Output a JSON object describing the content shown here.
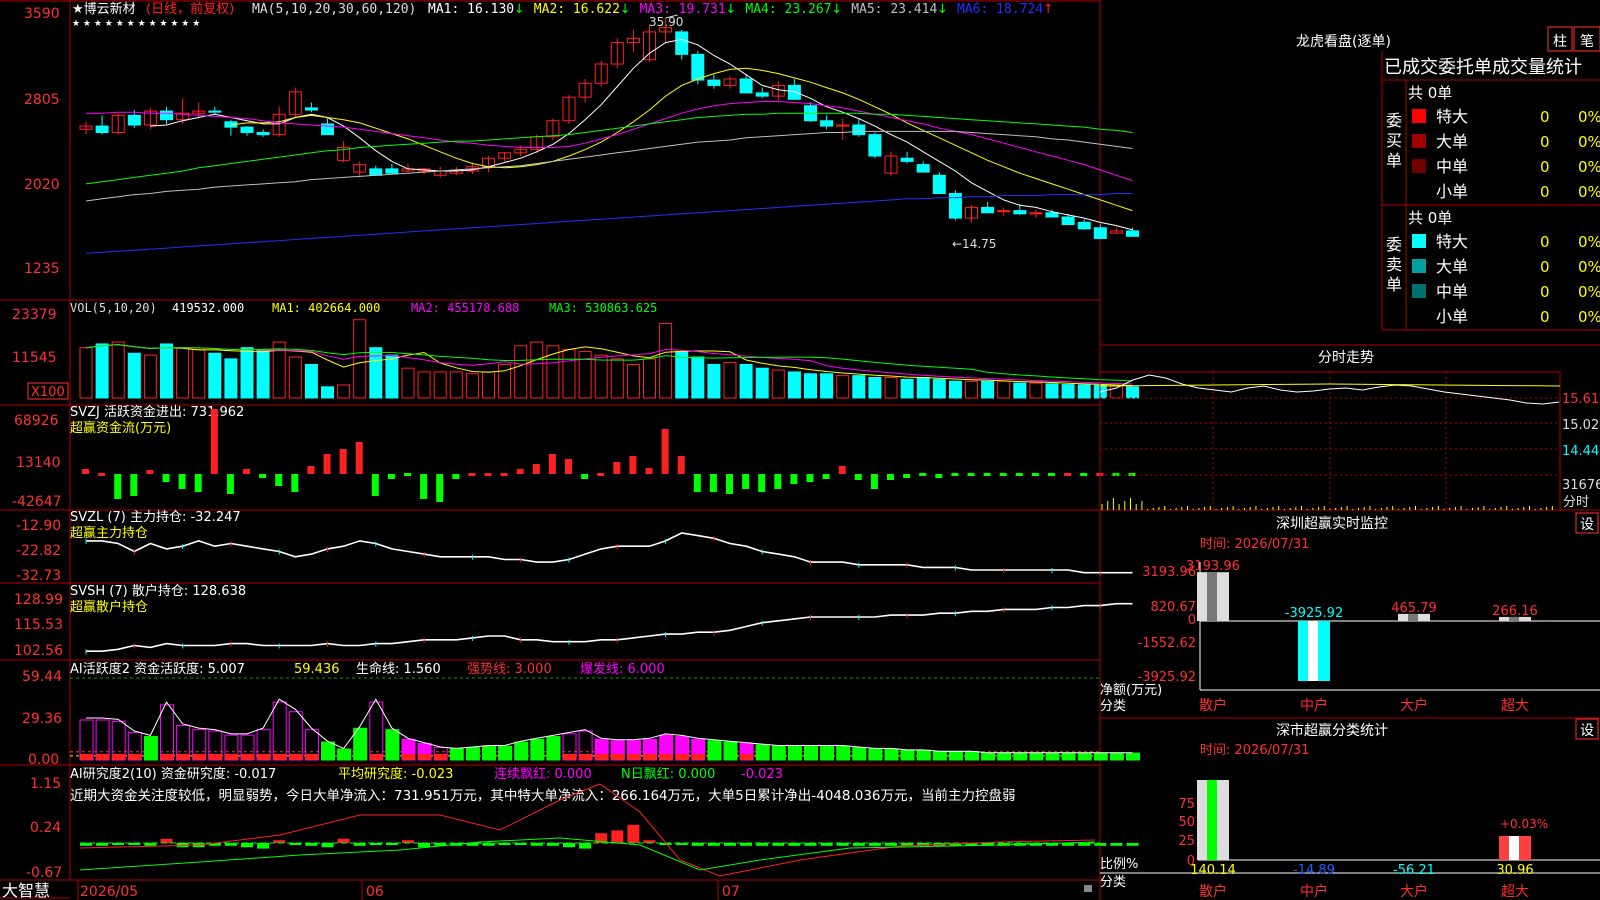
{
  "colors": {
    "up": "#ff2020",
    "down": "#00ffff",
    "green": "#00ff00",
    "yellow": "#ffff00",
    "magenta": "#ff00ff",
    "white": "#ffffff",
    "grid": "#b00000",
    "blue": "#2030ff",
    "grey": "#c0c0c0"
  },
  "kline": {
    "stock_name": "★博云新材",
    "mode": "(日线，前复权)",
    "ma_params": "MA(5,10,20,30,60,120)",
    "ma_values": [
      {
        "label": "MA1: 16.130",
        "arrow": "↓",
        "color": "#ffffff"
      },
      {
        "label": "MA2: 16.622",
        "arrow": "↓",
        "color": "#ffff00"
      },
      {
        "label": "MA3: 19.731",
        "arrow": "↓",
        "color": "#ff00ff"
      },
      {
        "label": "MA4: 23.267",
        "arrow": "↓",
        "color": "#00ff00"
      },
      {
        "label": "MA5: 23.414",
        "arrow": "↓",
        "color": "#c0c0c0"
      },
      {
        "label": "MA6: 18.724",
        "arrow": "↑",
        "color": "#2030ff"
      }
    ],
    "y_ticks": [
      "3590",
      "2805",
      "2020",
      "1235"
    ],
    "high_label": "35.90",
    "low_label": "←14.75",
    "stars": "★ ★ ★ ★ ★ ★ ★ ★ ★ ★ ★ ★"
  },
  "chart_data": {
    "type": "candlestick",
    "ylim": [
      12.35,
      35.9
    ],
    "candles": [
      [
        25.5,
        26.2,
        25.0,
        25.8
      ],
      [
        25.8,
        26.8,
        25.0,
        25.2
      ],
      [
        25.2,
        27.0,
        25.0,
        26.8
      ],
      [
        26.8,
        27.3,
        25.6,
        25.9
      ],
      [
        25.9,
        27.5,
        25.5,
        27.2
      ],
      [
        27.2,
        27.6,
        26.0,
        26.4
      ],
      [
        26.4,
        28.4,
        26.0,
        27.0
      ],
      [
        27.0,
        28.0,
        26.6,
        27.2
      ],
      [
        27.2,
        27.6,
        26.9,
        27.1
      ],
      [
        26.2,
        26.4,
        24.9,
        25.7
      ],
      [
        25.7,
        25.8,
        24.9,
        25.2
      ],
      [
        25.2,
        25.5,
        24.8,
        25.0
      ],
      [
        25.0,
        27.6,
        24.8,
        26.9
      ],
      [
        26.9,
        29.4,
        26.6,
        29.0
      ],
      [
        27.5,
        28.0,
        27.1,
        27.3
      ],
      [
        26.0,
        26.5,
        25.2,
        25.0
      ],
      [
        22.6,
        24.4,
        22.4,
        23.8
      ],
      [
        21.5,
        22.5,
        21.0,
        22.2
      ],
      [
        21.8,
        22.1,
        21.5,
        21.2
      ],
      [
        21.8,
        22.3,
        21.3,
        21.4
      ],
      [
        21.6,
        22.3,
        21.5,
        21.8
      ],
      [
        21.6,
        21.9,
        21.3,
        21.8
      ],
      [
        21.2,
        22.0,
        21.0,
        21.6
      ],
      [
        21.4,
        22.0,
        21.2,
        21.7
      ],
      [
        21.6,
        22.4,
        21.3,
        22.0
      ],
      [
        22.0,
        23.0,
        21.5,
        22.8
      ],
      [
        22.8,
        23.4,
        22.5,
        23.3
      ],
      [
        23.3,
        24.0,
        23.0,
        23.6
      ],
      [
        23.6,
        25.0,
        23.3,
        24.8
      ],
      [
        24.8,
        26.5,
        24.5,
        26.3
      ],
      [
        26.3,
        28.7,
        26.0,
        28.5
      ],
      [
        28.5,
        30.2,
        28.0,
        29.8
      ],
      [
        29.8,
        31.9,
        29.5,
        31.6
      ],
      [
        31.6,
        34.0,
        31.2,
        33.6
      ],
      [
        33.6,
        34.8,
        32.7,
        34.0
      ],
      [
        32.0,
        35.3,
        31.8,
        34.6
      ],
      [
        34.6,
        35.9,
        33.5,
        35.0
      ],
      [
        34.6,
        34.8,
        32.0,
        32.5
      ],
      [
        32.5,
        32.8,
        29.7,
        30.1
      ],
      [
        30.1,
        30.6,
        29.3,
        29.6
      ],
      [
        29.6,
        30.5,
        29.3,
        30.2
      ],
      [
        30.2,
        30.6,
        29.0,
        28.9
      ],
      [
        28.9,
        29.4,
        28.4,
        28.6
      ],
      [
        28.6,
        30.0,
        28.2,
        29.6
      ],
      [
        29.6,
        30.2,
        28.3,
        28.3
      ],
      [
        27.7,
        28.0,
        26.2,
        26.3
      ],
      [
        26.3,
        26.8,
        25.5,
        25.8
      ],
      [
        25.8,
        26.5,
        24.5,
        25.9
      ],
      [
        25.9,
        26.5,
        24.8,
        25.0
      ],
      [
        25.0,
        25.2,
        22.8,
        23.0
      ],
      [
        21.4,
        23.4,
        21.1,
        23.0
      ],
      [
        22.8,
        23.4,
        22.3,
        22.5
      ],
      [
        22.2,
        22.5,
        21.6,
        21.5
      ],
      [
        21.2,
        21.5,
        19.9,
        19.5
      ],
      [
        19.5,
        19.8,
        17.0,
        17.2
      ],
      [
        17.2,
        18.4,
        16.8,
        18.2
      ],
      [
        18.2,
        18.7,
        17.8,
        17.7
      ],
      [
        17.8,
        18.2,
        17.4,
        17.9
      ],
      [
        17.9,
        18.5,
        17.5,
        17.6
      ],
      [
        17.6,
        18.0,
        17.2,
        17.7
      ],
      [
        17.7,
        18.0,
        17.3,
        17.3
      ],
      [
        17.3,
        17.6,
        16.6,
        16.6
      ],
      [
        16.8,
        17.1,
        16.1,
        16.2
      ],
      [
        16.3,
        16.6,
        15.2,
        15.3
      ],
      [
        15.8,
        16.3,
        15.8,
        16.0
      ],
      [
        16.0,
        16.3,
        15.6,
        15.5
      ]
    ],
    "ma": [
      [
        null,
        null,
        null,
        null,
        25.8,
        25.9,
        26.3,
        26.6,
        26.9,
        26.6,
        26.3,
        26.0,
        26.0,
        26.6,
        26.9,
        26.6,
        25.8,
        24.7,
        23.5,
        22.5,
        21.8,
        21.7,
        21.6,
        21.6,
        21.7,
        22.0,
        22.4,
        22.8,
        23.4,
        24.1,
        25.1,
        26.4,
        27.8,
        29.5,
        31.2,
        32.6,
        33.6,
        33.9,
        33.4,
        32.4,
        31.6,
        30.6,
        29.6,
        29.2,
        29.0,
        28.4,
        27.6,
        27.1,
        26.5,
        25.8,
        25.0,
        24.3,
        23.4,
        22.5,
        21.6,
        20.5,
        19.7,
        18.9,
        18.4,
        18.2,
        17.8,
        17.5,
        17.2,
        16.8,
        16.5,
        16.1
      ],
      [
        null,
        null,
        null,
        null,
        null,
        null,
        null,
        null,
        null,
        25.9,
        26.1,
        26.1,
        26.2,
        26.6,
        26.8,
        26.6,
        26.4,
        26.1,
        25.6,
        25.1,
        24.6,
        24.0,
        23.4,
        22.8,
        22.3,
        22.0,
        21.9,
        22.0,
        22.2,
        22.5,
        23.0,
        23.6,
        24.3,
        25.2,
        26.2,
        27.3,
        28.6,
        29.6,
        30.2,
        30.7,
        31.1,
        31.2,
        31.0,
        30.7,
        30.3,
        29.9,
        29.4,
        28.9,
        28.3,
        27.6,
        26.9,
        26.1,
        25.4,
        24.7,
        24.0,
        23.3,
        22.6,
        22.0,
        21.4,
        20.9,
        20.4,
        19.9,
        19.4,
        18.9,
        18.4,
        17.9
      ],
      [
        27.0,
        27.0,
        27.1,
        27.1,
        27.0,
        27.0,
        26.9,
        26.8,
        26.7,
        26.6,
        26.5,
        26.3,
        26.1,
        26.0,
        25.9,
        25.8,
        25.7,
        25.5,
        25.3,
        25.1,
        24.9,
        24.7,
        24.5,
        24.3,
        24.2,
        24.0,
        23.9,
        23.8,
        23.8,
        23.8,
        23.9,
        24.2,
        24.6,
        25.0,
        25.5,
        26.0,
        26.5,
        27.0,
        27.4,
        27.7,
        27.9,
        28.0,
        28.1,
        28.1,
        28.0,
        27.9,
        27.7,
        27.5,
        27.2,
        26.9,
        26.6,
        26.3,
        26.0,
        25.6,
        25.3,
        25.0,
        24.6,
        24.2,
        23.8,
        23.4,
        23.0,
        22.6,
        22.2,
        21.7,
        21.2,
        20.7
      ],
      [
        20.4,
        20.6,
        20.8,
        21.0,
        21.2,
        21.4,
        21.6,
        21.9,
        22.1,
        22.3,
        22.5,
        22.7,
        22.9,
        23.1,
        23.3,
        23.5,
        23.6,
        23.8,
        23.9,
        24.0,
        24.1,
        24.2,
        24.3,
        24.4,
        24.4,
        24.5,
        24.6,
        24.7,
        24.8,
        24.9,
        25.0,
        25.2,
        25.4,
        25.6,
        25.8,
        26.0,
        26.2,
        26.4,
        26.6,
        26.7,
        26.8,
        26.9,
        26.9,
        27.0,
        27.0,
        27.0,
        27.0,
        27.0,
        27.0,
        26.9,
        26.9,
        26.8,
        26.7,
        26.6,
        26.5,
        26.4,
        26.3,
        26.2,
        26.1,
        26.0,
        25.9,
        25.8,
        25.7,
        25.5,
        25.4,
        25.2
      ],
      [
        18.8,
        19.0,
        19.2,
        19.4,
        19.5,
        19.7,
        19.8,
        19.9,
        20.1,
        20.2,
        20.3,
        20.4,
        20.5,
        20.6,
        20.8,
        20.9,
        21.0,
        21.1,
        21.2,
        21.3,
        21.4,
        21.5,
        21.6,
        21.7,
        21.8,
        21.9,
        22.0,
        22.1,
        22.3,
        22.5,
        22.7,
        22.9,
        23.1,
        23.3,
        23.5,
        23.7,
        23.9,
        24.1,
        24.3,
        24.4,
        24.5,
        24.7,
        24.8,
        24.9,
        25.0,
        25.1,
        25.2,
        25.2,
        25.3,
        25.3,
        25.3,
        25.3,
        25.3,
        25.3,
        25.3,
        25.2,
        25.1,
        25.0,
        24.9,
        24.8,
        24.6,
        24.5,
        24.3,
        24.1,
        23.9,
        23.7
      ],
      [
        13.9,
        14.0,
        14.1,
        14.2,
        14.3,
        14.4,
        14.5,
        14.6,
        14.7,
        14.8,
        14.9,
        15.0,
        15.1,
        15.2,
        15.3,
        15.4,
        15.5,
        15.6,
        15.7,
        15.8,
        15.9,
        16.0,
        16.1,
        16.2,
        16.3,
        16.4,
        16.5,
        16.6,
        16.7,
        16.8,
        16.9,
        17.0,
        17.1,
        17.2,
        17.3,
        17.4,
        17.5,
        17.6,
        17.7,
        17.8,
        17.9,
        18.0,
        18.1,
        18.2,
        18.3,
        18.4,
        18.5,
        18.6,
        18.7,
        18.8,
        18.9,
        19.0,
        19.0,
        19.1,
        19.1,
        19.2,
        19.2,
        19.3,
        19.3,
        19.3,
        19.4,
        19.4,
        19.4,
        19.4,
        19.5,
        19.5
      ]
    ],
    "x_labels": [
      "2026/05",
      "06",
      "07"
    ]
  },
  "volume": {
    "params": "VOL(5,10,20)",
    "value": "419532.000",
    "ma1": "MA1: 402664.000",
    "ma2": "MA2: 455178.688",
    "ma3": "MA3: 530863.625",
    "y_ticks": [
      "23379",
      "11545"
    ],
    "unit": "X100",
    "bars": [
      13.5,
      14.5,
      15,
      12,
      11.5,
      14.5,
      13.5,
      13,
      12,
      10.5,
      13.5,
      13,
      15,
      11,
      9,
      3,
      3.5,
      21,
      13.5,
      11.5,
      8,
      7,
      7,
      7,
      6.5,
      7,
      9,
      14,
      15,
      14,
      13,
      12.5,
      11.5,
      10.5,
      9,
      10.5,
      20,
      12.5,
      11,
      9,
      9.5,
      9,
      8,
      7.5,
      7,
      6.5,
      6.5,
      6,
      6,
      5.5,
      5.5,
      5,
      5.5,
      5,
      4.5,
      4.5,
      4.5,
      4.5,
      4,
      4,
      3.8,
      3.6,
      3.5,
      3.4,
      3.2,
      3.0
    ]
  },
  "svzj": {
    "title": "SVZJ  活跃资金进出: 731.962",
    "subtitle": "超赢资金流(万元)",
    "y_ticks": [
      "68926",
      "13140",
      "-42647"
    ],
    "values": [
      0.5,
      0.3,
      -2.5,
      -2.2,
      0.4,
      -0.8,
      -1.5,
      -1.8,
      6.5,
      -2,
      0.5,
      -0.4,
      -1.2,
      -1.8,
      0.8,
      2,
      2.5,
      3.2,
      -2.2,
      -0.5,
      -0.3,
      -2.5,
      -2.8,
      -0.5,
      0.3,
      0.2,
      0.3,
      0.5,
      1,
      2,
      1.5,
      -0.5,
      0.3,
      1.2,
      1.8,
      0.6,
      4.5,
      1.8,
      -1.8,
      -1.8,
      -2,
      -1.5,
      -1.8,
      -1.5,
      -1,
      -0.8,
      -0.5,
      0.8,
      -0.6,
      -1.5,
      -0.6,
      -0.4,
      -0.3,
      -0.4,
      -0.3,
      -0.2,
      -0.3,
      -0.2,
      -0.2,
      -0.2,
      -0.2,
      0.2,
      -0.2,
      0.2,
      -0.2,
      -0.2
    ]
  },
  "svzl": {
    "title": "SVZL (7) 主力持仓: -32.247",
    "subtitle": "超赢主力持仓",
    "y_ticks": [
      "-12.90",
      "-22.82",
      "-32.73"
    ],
    "values": [
      -20,
      -20,
      -21,
      -24,
      -21,
      -23,
      -22,
      -20,
      -22,
      -21,
      -22,
      -23,
      -24,
      -26,
      -25,
      -23,
      -22,
      -20,
      -21,
      -23,
      -24,
      -25,
      -26,
      -26,
      -26,
      -26,
      -27,
      -27,
      -28,
      -28,
      -27,
      -25,
      -23,
      -22,
      -22,
      -22,
      -20,
      -17,
      -18,
      -19,
      -21,
      -22,
      -24,
      -25,
      -26,
      -28,
      -28,
      -28,
      -29,
      -29,
      -29,
      -29,
      -30,
      -30,
      -30,
      -31,
      -31,
      -31,
      -31,
      -31,
      -31,
      -31,
      -32,
      -32,
      -32,
      -32
    ]
  },
  "svsh": {
    "title": "SVSH (7) 散户持仓: 128.638",
    "subtitle": "超赢散户持仓",
    "y_ticks": [
      "128.99",
      "115.53",
      "102.56"
    ],
    "values": [
      103,
      103,
      104,
      106,
      105,
      107,
      106,
      106,
      106,
      107,
      107,
      106,
      106,
      106,
      106,
      107,
      106,
      106,
      107,
      107,
      108,
      109,
      109,
      109,
      110,
      111,
      111,
      109,
      109,
      108,
      108,
      108,
      109,
      109,
      110,
      111,
      112,
      112,
      113,
      113,
      114,
      116,
      118,
      119,
      120,
      121,
      121,
      121,
      121,
      121,
      122,
      122,
      122,
      123,
      123,
      124,
      124,
      125,
      125,
      125,
      126,
      126,
      127,
      127,
      128,
      128
    ]
  },
  "ai_huoyue": {
    "title": "AI活跃度2 资金活跃度: 5.007",
    "value2": "59.436",
    "life_line": "生命线: 1.560",
    "strong_line": "强势线: 3.000",
    "burst_line": "爆发线: 6.000",
    "y_ticks": [
      "59.44",
      "29.36",
      "0.00"
    ],
    "bars": [
      29,
      29,
      28,
      20,
      17,
      40,
      25,
      22,
      21,
      18,
      18,
      22,
      42,
      35,
      22,
      13,
      8,
      23,
      42,
      22,
      15,
      12,
      9,
      8,
      9,
      10,
      10,
      13,
      15,
      17,
      19,
      21,
      15,
      14,
      14,
      15,
      18,
      17,
      15,
      14,
      13,
      12,
      11,
      10,
      10,
      10,
      10,
      10,
      9,
      8,
      8,
      7,
      7,
      6,
      6,
      6,
      5,
      5,
      5,
      5,
      5,
      5,
      5,
      5,
      5,
      5
    ],
    "styles": [
      "o",
      "o",
      "o",
      "o",
      "g",
      "o",
      "o",
      "o",
      "o",
      "o",
      "o",
      "o",
      "o",
      "o",
      "o",
      "g",
      "g",
      "g",
      "o",
      "g",
      "m",
      "m",
      "o",
      "g",
      "g",
      "g",
      "g",
      "g",
      "g",
      "g",
      "o",
      "o",
      "m",
      "m",
      "m",
      "m",
      "m",
      "m",
      "m",
      "g",
      "g",
      "m",
      "g",
      "g",
      "g",
      "g",
      "g",
      "g",
      "g",
      "g",
      "g",
      "g",
      "g",
      "g",
      "g",
      "g",
      "g",
      "g",
      "g",
      "g",
      "g",
      "g",
      "g",
      "g",
      "g",
      "g"
    ]
  },
  "ai_yanjiu": {
    "title": "AI研究度2(10) 资金研究度: -0.017",
    "avg": "平均研究度: -0.023",
    "red": "连续飘红: 0.000",
    "nred": "N日飘红: 0.000",
    "last": "-0.023",
    "y_ticks": [
      "1.15",
      "0.24",
      "-0.67"
    ],
    "summary": "近期大资金关注度较低，明显弱势，今日大单净流入：731.951万元，其中特大单净流入：266.164万元，大单5日累计净出-4048.036万元，当前主力控盘弱"
  },
  "date_axis": [
    "2026/05",
    "06",
    "07"
  ],
  "brand": "大智慧",
  "right_panel": {
    "lhb_title": "龙虎看盘(逐单)",
    "tab_zhu": "柱",
    "tab_bi": "笔",
    "stats_title": "已成交委托单成交量统计",
    "buy_label": "委买单",
    "sell_label": "委卖单",
    "buy_total": "共 0单",
    "sell_total": "共 0单",
    "buy_rows": [
      {
        "name": "特大",
        "color": "#ff0000",
        "value": "0",
        "pct": "0%"
      },
      {
        "name": "大单",
        "color": "#a00000",
        "value": "0",
        "pct": "0%"
      },
      {
        "name": "中单",
        "color": "#700000",
        "value": "0",
        "pct": "0%"
      },
      {
        "name": "小单",
        "color": "",
        "value": "0",
        "pct": "0%"
      }
    ],
    "sell_rows": [
      {
        "name": "特大",
        "color": "#00ffff",
        "value": "0",
        "pct": "0%"
      },
      {
        "name": "大单",
        "color": "#00a0a0",
        "value": "0",
        "pct": "0%"
      },
      {
        "name": "中单",
        "color": "#007070",
        "value": "0",
        "pct": "0%"
      },
      {
        "name": "小单",
        "color": "",
        "value": "0",
        "pct": "0%"
      }
    ],
    "intraday_title": "分时走势",
    "intraday_y": [
      "15.61",
      "15.02",
      "14.44",
      "31676"
    ],
    "intraday_unit": "分时",
    "monitor_title": "深圳超赢实时监控",
    "monitor_date": "时间: 2026/07/31",
    "monitor_y": [
      "3193.96",
      "820.67",
      "0",
      "-1552.62",
      "-3925.92"
    ],
    "monitor_ylabel": "净额(万元)",
    "monitor_xlabel": "分类",
    "monitor_bars": [
      {
        "cat": "散户",
        "value": 3193.96,
        "label": "3193.96"
      },
      {
        "cat": "中户",
        "value": -3925.92,
        "label": "-3925.92"
      },
      {
        "cat": "大户",
        "value": 465.79,
        "label": "465.79"
      },
      {
        "cat": "超大",
        "value": 266.16,
        "label": "266.16"
      }
    ],
    "set_label": "设",
    "class_title": "深市超赢分类统计",
    "class_date": "时间: 2026/07/31",
    "class_y": [
      "75",
      "50",
      "25",
      "0"
    ],
    "class_ylabel": "比例%",
    "class_xlabel": "分类",
    "class_pct": "+0.03%",
    "class_values": [
      {
        "cat": "散户",
        "value": 140.14,
        "label": "140.14"
      },
      {
        "cat": "中户",
        "value": -14.89,
        "label": "-14.89"
      },
      {
        "cat": "大户",
        "value": -56.21,
        "label": "-56.21"
      },
      {
        "cat": "超大",
        "value": 30.96,
        "label": "30.96"
      }
    ]
  }
}
